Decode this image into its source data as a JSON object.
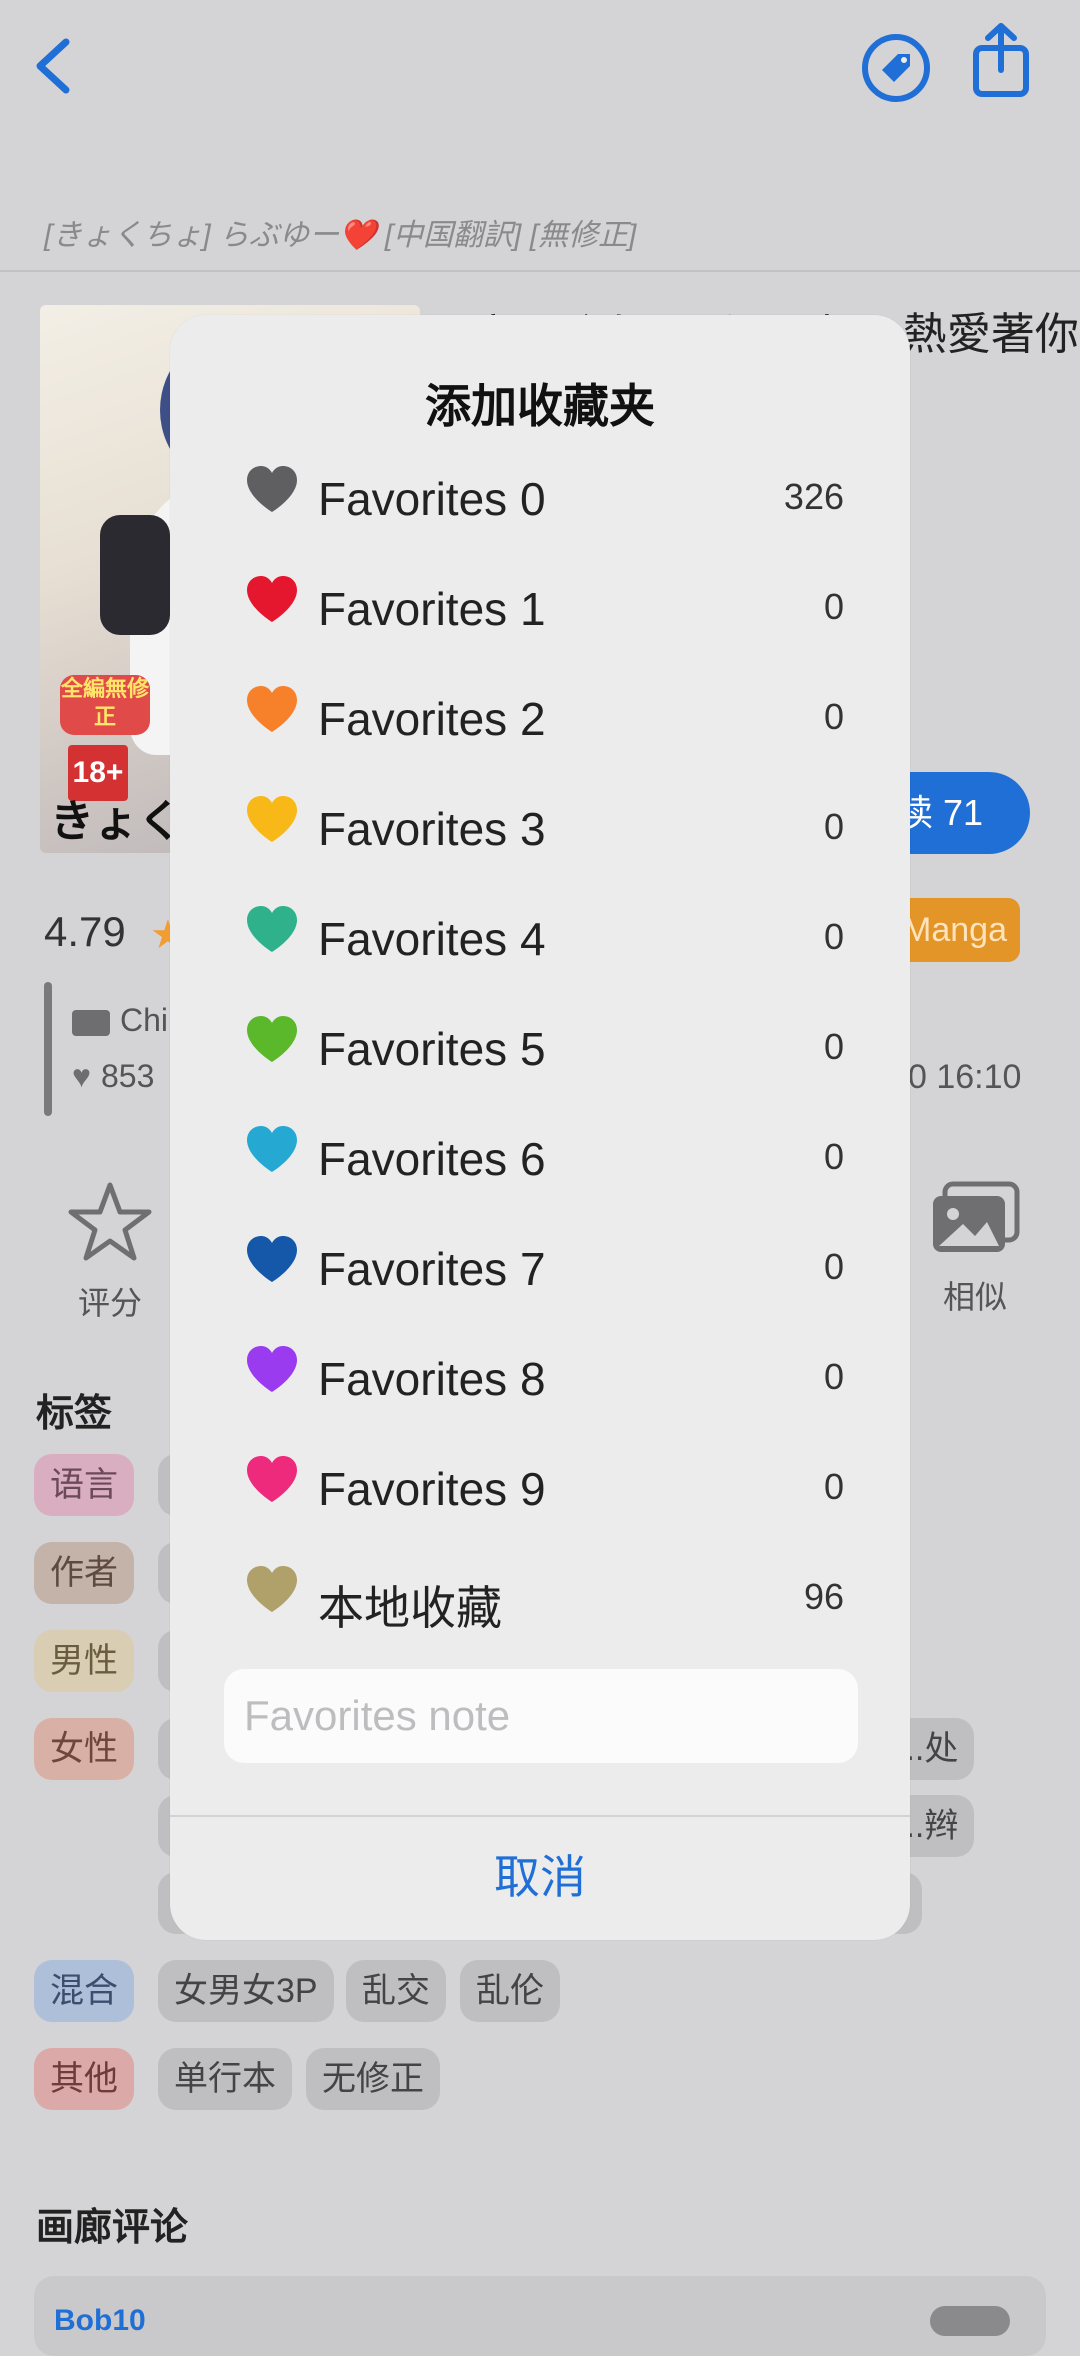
{
  "header": {
    "subtitle": "[きょくちょ] らぶゆー❤️ [中国翻訳] [無修正]"
  },
  "gallery": {
    "title_fragment": "[きょくちょ] らぶゆー 熱愛著你",
    "cover_text": {
      "author": "きょく",
      "badge": "18+",
      "sticker": "全編無修正"
    },
    "read_button": "读 71",
    "rating": "4.79",
    "category": "Manga",
    "language": "Chi",
    "favorites": "853",
    "posted_time": "0 16:10"
  },
  "actions": {
    "rate_label": "评分",
    "similar_label": "相似"
  },
  "tags": {
    "heading": "标签",
    "rows": [
      {
        "namespace": "语言",
        "values": []
      },
      {
        "namespace": "作者",
        "values": []
      },
      {
        "namespace": "男性",
        "values": []
      },
      {
        "namespace": "女性",
        "values": [
          "...处"
        ]
      },
      {
        "namespace": "",
        "values": [
          "...辫"
        ]
      },
      {
        "namespace": "混合",
        "values": [
          "女男女3P",
          "乱交",
          "乱伦"
        ]
      },
      {
        "namespace": "其他",
        "values": [
          "单行本",
          "无修正"
        ]
      }
    ]
  },
  "comments": {
    "heading": "画廊评论",
    "first_user": "Bob10"
  },
  "dialog": {
    "title": "添加收藏夹",
    "items": [
      {
        "name": "Favorites 0",
        "count": "326",
        "color": "#5f5f61"
      },
      {
        "name": "Favorites 1",
        "count": "0",
        "color": "#e5172f"
      },
      {
        "name": "Favorites 2",
        "count": "0",
        "color": "#f7812a"
      },
      {
        "name": "Favorites 3",
        "count": "0",
        "color": "#f8b817"
      },
      {
        "name": "Favorites 4",
        "count": "0",
        "color": "#2fb28b"
      },
      {
        "name": "Favorites 5",
        "count": "0",
        "color": "#5ab82a"
      },
      {
        "name": "Favorites 6",
        "count": "0",
        "color": "#25a9d3"
      },
      {
        "name": "Favorites 7",
        "count": "0",
        "color": "#1557a8"
      },
      {
        "name": "Favorites 8",
        "count": "0",
        "color": "#9a3bf0"
      },
      {
        "name": "Favorites 9",
        "count": "0",
        "color": "#ee2a7d"
      },
      {
        "name": "本地收藏",
        "count": "96",
        "color": "#b0a16a"
      }
    ],
    "note_placeholder": "Favorites note",
    "cancel_label": "取消"
  }
}
